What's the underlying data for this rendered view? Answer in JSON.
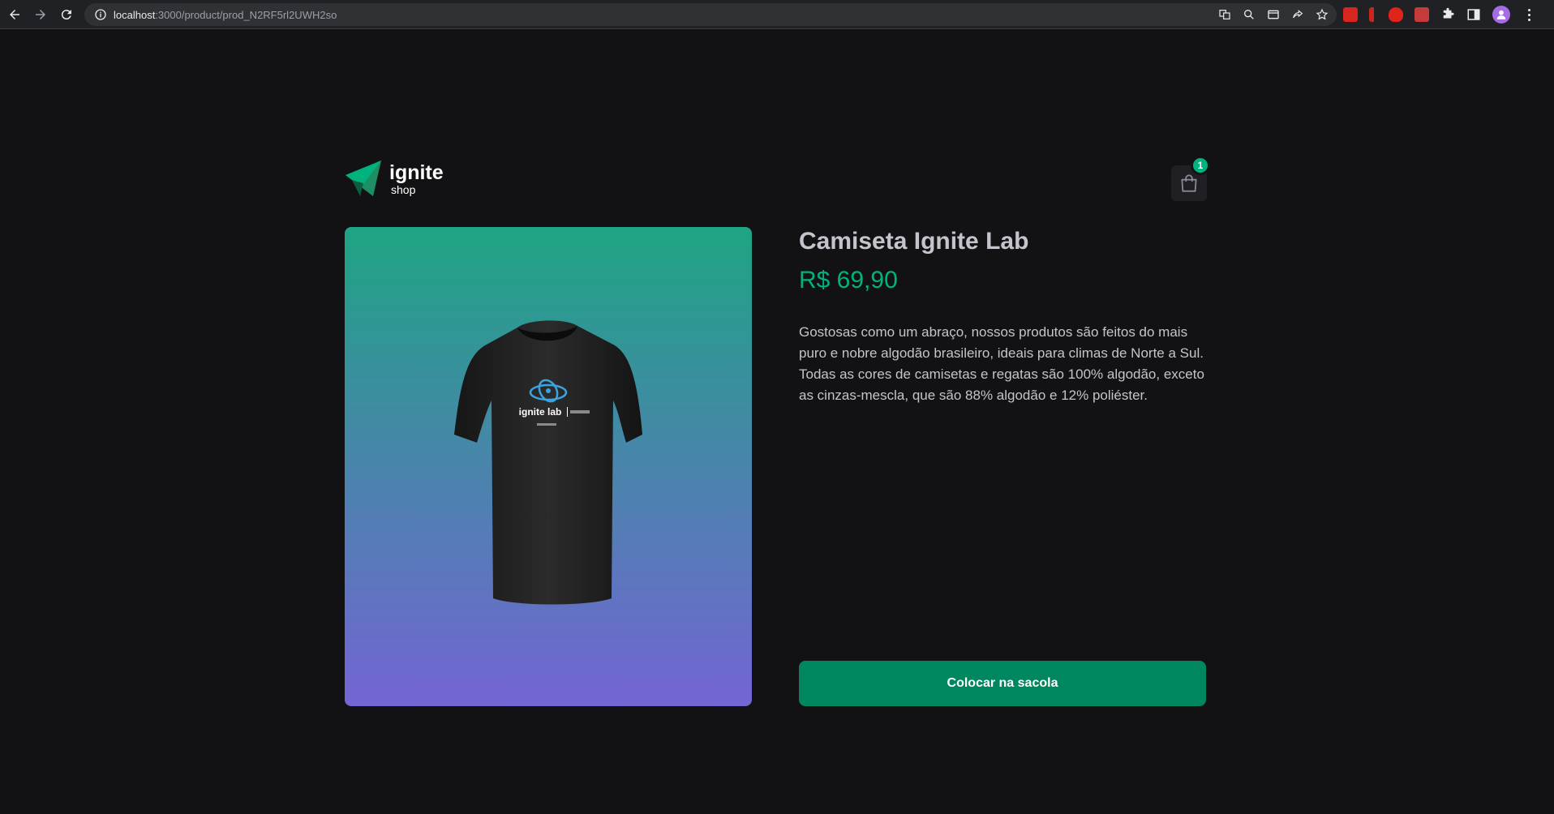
{
  "browser": {
    "url_host": "localhost",
    "url_rest": ":3000/product/prod_N2RF5rl2UWH2so"
  },
  "header": {
    "logo_main": "ignite",
    "logo_sub": "shop",
    "cart_count": "1"
  },
  "product": {
    "title": "Camiseta Ignite Lab",
    "price": "R$ 69,90",
    "description": "Gostosas como um abraço, nossos produtos são feitos do mais puro e nobre algodão brasileiro, ideais para climas de Norte a Sul. Todas as cores de camisetas e regatas são 100% algodão, exceto as cinzas-mescla, que são 88% algodão e 12% poliéster.",
    "shirt_print": "ignite lab",
    "buy_label": "Colocar na sacola"
  },
  "colors": {
    "background": "#121214",
    "accent": "#00875f",
    "accent_light": "#00b37e",
    "gradient_top": "#1ea483",
    "gradient_bottom": "#7465d4"
  }
}
